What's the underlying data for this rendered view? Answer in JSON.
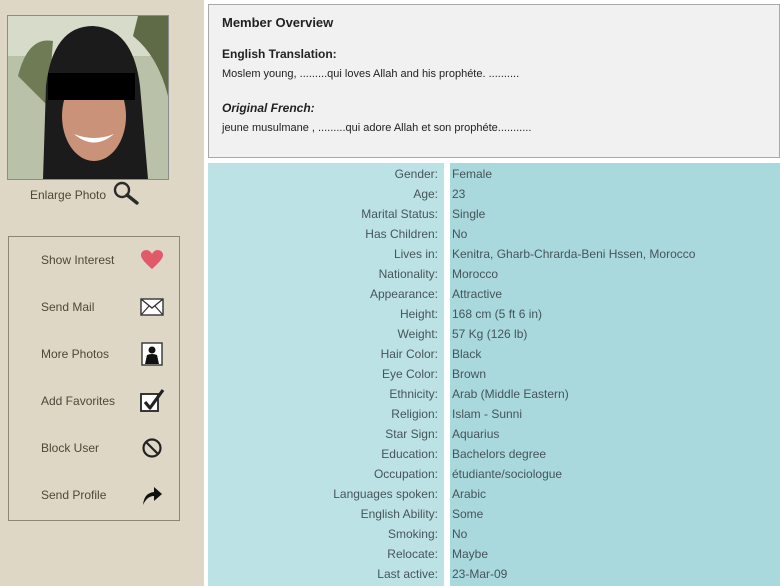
{
  "sidebar": {
    "enlarge_label": "Enlarge Photo",
    "actions": [
      {
        "label": "Show Interest",
        "icon": "heart-icon"
      },
      {
        "label": "Send Mail",
        "icon": "envelope-icon"
      },
      {
        "label": "More Photos",
        "icon": "person-photo-icon"
      },
      {
        "label": "Add Favorites",
        "icon": "checkbox-check-icon"
      },
      {
        "label": "Block User",
        "icon": "block-icon"
      },
      {
        "label": "Send Profile",
        "icon": "forward-arrow-icon"
      }
    ]
  },
  "overview": {
    "title": "Member Overview",
    "english_heading": "English Translation:",
    "english_text": "Moslem young, .........qui loves Allah and his prophéte. ..........",
    "french_heading": "Original French:",
    "french_text": "jeune musulmane , .........qui adore Allah et son prophéte..........."
  },
  "details": [
    {
      "key": "Gender:",
      "value": "Female"
    },
    {
      "key": "Age:",
      "value": "23"
    },
    {
      "key": "Marital Status:",
      "value": "Single"
    },
    {
      "key": "Has Children:",
      "value": "No"
    },
    {
      "key": "Lives in:",
      "value": "Kenitra, Gharb-Chrarda-Beni Hssen, Morocco"
    },
    {
      "key": "Nationality:",
      "value": "Morocco"
    },
    {
      "key": "Appearance:",
      "value": "Attractive"
    },
    {
      "key": "Height:",
      "value": "168 cm (5 ft 6 in)"
    },
    {
      "key": "Weight:",
      "value": "57 Kg (126 lb)"
    },
    {
      "key": "Hair Color:",
      "value": "Black"
    },
    {
      "key": "Eye Color:",
      "value": "Brown"
    },
    {
      "key": "Ethnicity:",
      "value": "Arab (Middle Eastern)"
    },
    {
      "key": "Religion:",
      "value": "Islam - Sunni"
    },
    {
      "key": "Star Sign:",
      "value": "Aquarius"
    },
    {
      "key": "Education:",
      "value": "Bachelors degree"
    },
    {
      "key": "Occupation:",
      "value": "étudiante/sociologue"
    },
    {
      "key": "Languages spoken:",
      "value": "Arabic"
    },
    {
      "key": "English Ability:",
      "value": "Some"
    },
    {
      "key": "Smoking:",
      "value": "No"
    },
    {
      "key": "Relocate:",
      "value": "Maybe"
    },
    {
      "key": "Last active:",
      "value": "23-Mar-09"
    }
  ]
}
